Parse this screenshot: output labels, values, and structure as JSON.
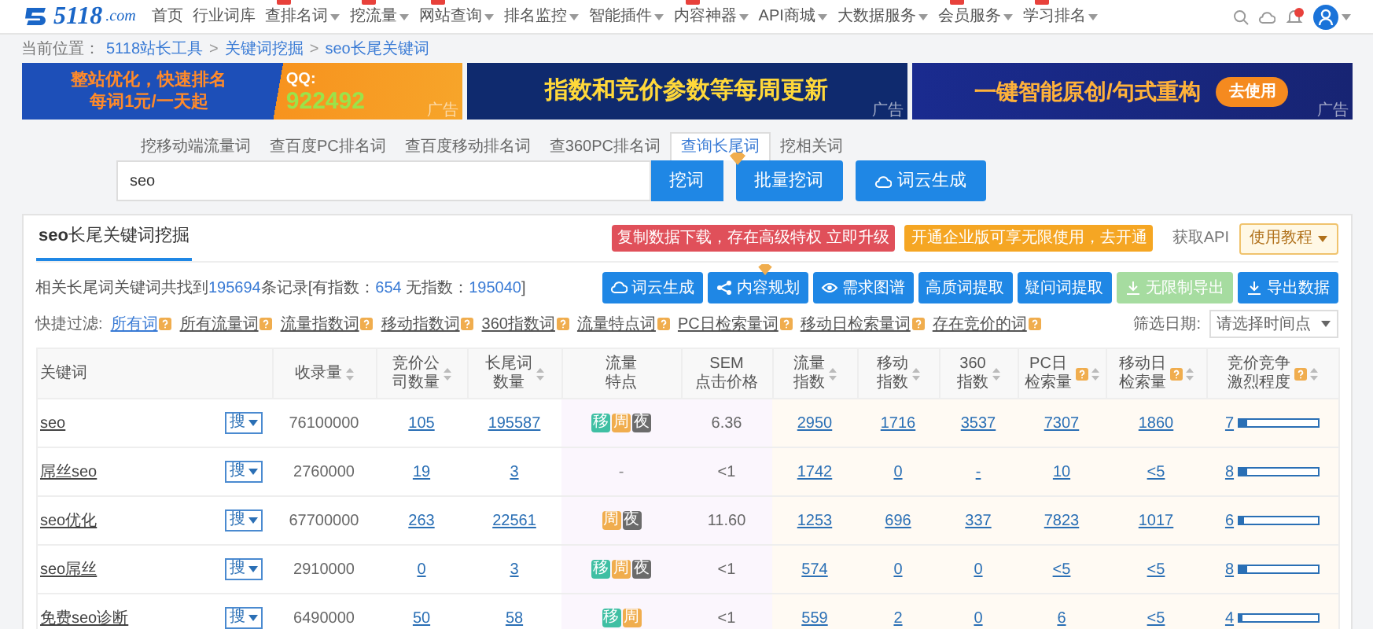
{
  "nav": {
    "logo": "5118",
    "logo_suffix": ".com",
    "items": [
      {
        "label": "首页",
        "caret": false,
        "tag": false
      },
      {
        "label": "行业词库",
        "caret": false,
        "tag": false
      },
      {
        "label": "查排名词",
        "caret": true,
        "tag": true
      },
      {
        "label": "挖流量",
        "caret": true,
        "tag": true
      },
      {
        "label": "网站查询",
        "caret": true,
        "tag": true
      },
      {
        "label": "排名监控",
        "caret": true,
        "tag": false
      },
      {
        "label": "智能插件",
        "caret": true,
        "tag": false
      },
      {
        "label": "内容神器",
        "caret": true,
        "tag": true
      },
      {
        "label": "API商城",
        "caret": true,
        "tag": false
      },
      {
        "label": "大数据服务",
        "caret": true,
        "tag": false
      },
      {
        "label": "会员服务",
        "caret": true,
        "tag": true
      },
      {
        "label": "学习排名",
        "caret": true,
        "tag": true
      }
    ]
  },
  "breadcrumb": [
    {
      "text": "当前位置：",
      "kind": "label"
    },
    {
      "text": "5118站长工具",
      "kind": "link"
    },
    {
      "text": ">",
      "kind": "sep"
    },
    {
      "text": "关键词挖掘",
      "kind": "link"
    },
    {
      "text": ">",
      "kind": "sep"
    },
    {
      "text": "seo长尾关键词",
      "kind": "link"
    }
  ],
  "banners": [
    {
      "kind": "promo",
      "lines": [
        "整站优化，快速排名",
        "每词1元/一天起"
      ],
      "qq_label": "QQ:",
      "qq_number": "922492",
      "ad": "广告"
    },
    {
      "kind": "notice",
      "text": "指数和竞价参数等每周更新",
      "ad": "广告"
    },
    {
      "kind": "tool",
      "text": "一键智能原创/句式重构",
      "button": "去使用",
      "ad": "广告"
    }
  ],
  "search": {
    "tabs": [
      {
        "label": "挖移动端流量词",
        "selected": false
      },
      {
        "label": "查百度PC排名词",
        "selected": false
      },
      {
        "label": "查百度移动排名词",
        "selected": false
      },
      {
        "label": "查360PC排名词",
        "selected": false
      },
      {
        "label": "查询长尾词",
        "selected": true
      },
      {
        "label": "挖相关词",
        "selected": false
      }
    ],
    "value": "seo",
    "buttons": [
      {
        "label": "挖词",
        "kind": "primary"
      },
      {
        "label": "批量挖词",
        "kind": "vip"
      },
      {
        "label": "词云生成",
        "kind": "cloud"
      }
    ]
  },
  "panel": {
    "title": "**seo**长尾关键词挖掘",
    "notices": [
      {
        "text": "复制数据下载，存在高级特权 立即升级",
        "kind": "upgrade"
      },
      {
        "text": "开通企业版可享无限使用，去开通",
        "kind": "enterprise"
      }
    ],
    "api_link": "获取API",
    "tutorial": "使用教程",
    "summary": [
      {
        "text": "相关长尾词关键词共找到",
        "highlight": false
      },
      {
        "text": "195694",
        "highlight": true
      },
      {
        "text": "条记录[有指数：",
        "highlight": false
      },
      {
        "text": "654",
        "highlight": true
      },
      {
        "text": " 无指数：",
        "highlight": false
      },
      {
        "text": "195040",
        "highlight": true
      },
      {
        "text": "]",
        "highlight": false
      }
    ],
    "toolbar": [
      {
        "label": "词云生成",
        "kind": "cloud",
        "disabled": false,
        "badge": false
      },
      {
        "label": "内容规划",
        "kind": "share",
        "disabled": false,
        "badge": true
      },
      {
        "label": "需求图谱",
        "kind": "eye",
        "disabled": false,
        "badge": false
      },
      {
        "label": "高质词提取",
        "kind": "plain",
        "disabled": false,
        "badge": false
      },
      {
        "label": "疑问词提取",
        "kind": "plain",
        "disabled": false,
        "badge": false
      },
      {
        "label": "无限制导出",
        "kind": "download",
        "disabled": true,
        "badge": false
      },
      {
        "label": "导出数据",
        "kind": "download",
        "disabled": false,
        "badge": false
      }
    ],
    "filters": {
      "label": "快捷过滤:",
      "items": [
        {
          "label": "所有词",
          "selected": true
        },
        {
          "label": "所有流量词",
          "selected": false
        },
        {
          "label": "流量指数词",
          "selected": false
        },
        {
          "label": "移动指数词",
          "selected": false
        },
        {
          "label": "360指数词",
          "selected": false
        },
        {
          "label": "流量特点词",
          "selected": false
        },
        {
          "label": "PC日检索量词",
          "selected": false
        },
        {
          "label": "移动日检索量词",
          "selected": false
        },
        {
          "label": "存在竞价的词",
          "selected": false
        }
      ],
      "date_label": "筛选日期:",
      "date_placeholder": "请选择时间点"
    }
  },
  "table": {
    "columns": [
      {
        "label": "关键词",
        "sortable": false,
        "help": false
      },
      {
        "label": "收录量",
        "sortable": true,
        "help": false
      },
      {
        "label": "竞价公司数量",
        "sortable": true,
        "help": false
      },
      {
        "label": "长尾词数量",
        "sortable": true,
        "help": false
      },
      {
        "label": "流量特点",
        "sortable": false,
        "help": false
      },
      {
        "label": "SEM",
        "sublabel": "点击价格",
        "sortable": false,
        "help": false
      },
      {
        "label": "流量指数",
        "sortable": true,
        "help": false
      },
      {
        "label": "移动指数",
        "sortable": true,
        "help": false
      },
      {
        "label": "360指数",
        "sortable": true,
        "help": false
      },
      {
        "label": "PC日检索量",
        "sortable": true,
        "help": true
      },
      {
        "label": "移动日检索量",
        "sortable": true,
        "help": true
      },
      {
        "label": "竞价竞争激烈程度",
        "sortable": true,
        "help": true
      }
    ],
    "rows": [
      {
        "keyword": "seo",
        "search": "搜",
        "indexed": "76100000",
        "companies": "105",
        "longtail": "195587",
        "features": [
          {
            "label": "移",
            "color": "#3fbfa3"
          },
          {
            "label": "周",
            "color": "#f0ad4e"
          },
          {
            "label": "夜",
            "color": "#6b6b6b"
          }
        ],
        "sem": "6.36",
        "values": [
          "2950",
          "1716",
          "3537",
          "7307",
          "1860"
        ],
        "competition": "7",
        "level": 0.1
      },
      {
        "keyword": "屌丝seo",
        "search": "搜",
        "indexed": "2760000",
        "companies": "19",
        "longtail": "3",
        "features": [],
        "features_empty": "-",
        "sem": "<1",
        "values": [
          "1742",
          "0",
          "-",
          "10",
          "<5"
        ],
        "competition": "8",
        "level": 0.1
      },
      {
        "keyword": "seo优化",
        "search": "搜",
        "indexed": "67700000",
        "companies": "263",
        "longtail": "22561",
        "features": [
          {
            "label": "周",
            "color": "#f0ad4e"
          },
          {
            "label": "夜",
            "color": "#6b6b6b"
          }
        ],
        "sem": "11.60",
        "values": [
          "1253",
          "696",
          "337",
          "7823",
          "1017"
        ],
        "competition": "6",
        "level": 0.06
      },
      {
        "keyword": "seo屌丝",
        "search": "搜",
        "indexed": "2910000",
        "companies": "0",
        "longtail": "3",
        "features": [
          {
            "label": "移",
            "color": "#3fbfa3"
          },
          {
            "label": "周",
            "color": "#f0ad4e"
          },
          {
            "label": "夜",
            "color": "#6b6b6b"
          }
        ],
        "sem": "<1",
        "values": [
          "574",
          "0",
          "0",
          "<5",
          "<5"
        ],
        "competition": "8",
        "level": 0.1
      },
      {
        "keyword": "免费seo诊断",
        "search": "搜",
        "indexed": "6490000",
        "companies": "50",
        "longtail": "58",
        "features": [
          {
            "label": "移",
            "color": "#3fbfa3"
          },
          {
            "label": "周",
            "color": "#f0ad4e"
          }
        ],
        "sem": "<1",
        "values": [
          "559",
          "2",
          "0",
          "6",
          "<5"
        ],
        "competition": "4",
        "level": 0.05
      }
    ]
  }
}
